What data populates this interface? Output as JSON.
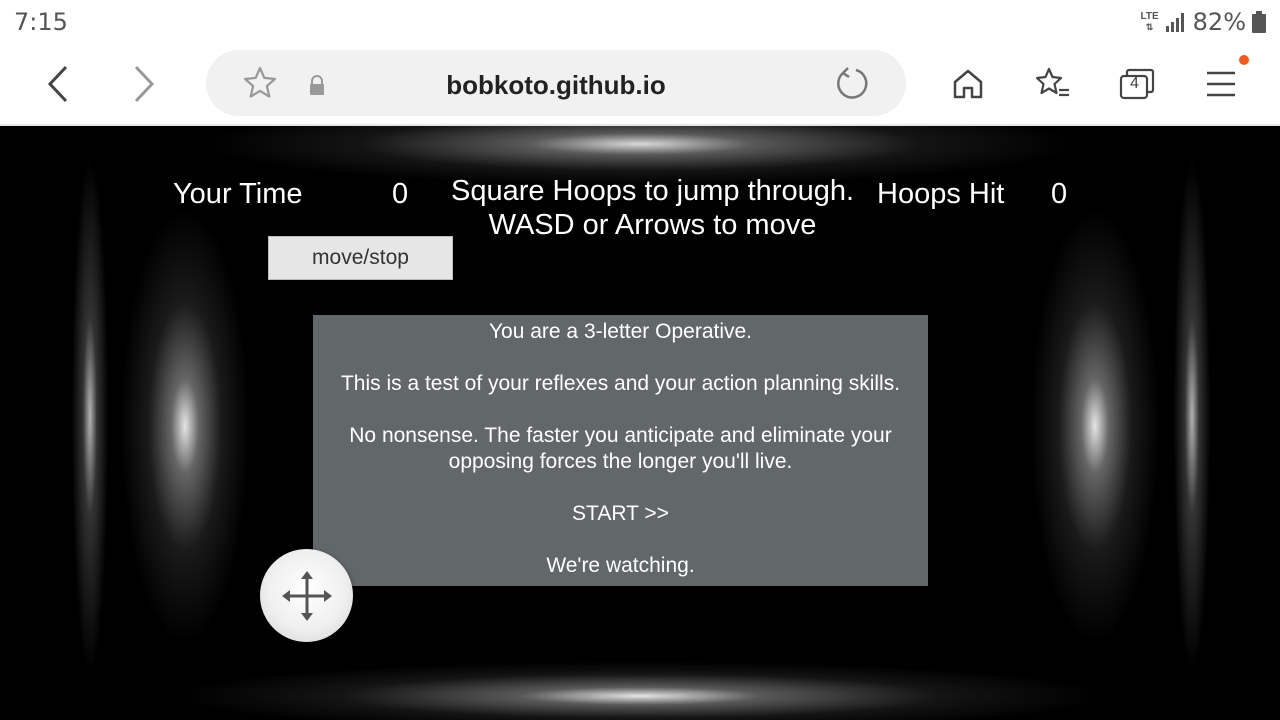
{
  "status_bar": {
    "time": "7:15",
    "network": "LTE",
    "battery": "82%"
  },
  "browser": {
    "url": "bobkoto.github.io",
    "tab_count": "4"
  },
  "game": {
    "your_time_label": "Your Time",
    "your_time_value": "0",
    "instructions_line1": "Square Hoops to jump through.",
    "instructions_line2": "WASD or Arrows to move",
    "hoops_hit_label": "Hoops Hit",
    "hoops_hit_value": "0",
    "move_stop_label": "move/stop",
    "dialog": {
      "line1": "You are a 3-letter Operative.",
      "line2": "This is a test of your reflexes and your action planning skills.",
      "line3a": "No nonsense. The faster you anticipate and eliminate your",
      "line3b": "opposing forces the longer you'll live.",
      "start": "START >>",
      "line4": "We're watching."
    }
  },
  "colors": {
    "dialog_bg": "#626769",
    "notification_dot": "#f05a22"
  }
}
